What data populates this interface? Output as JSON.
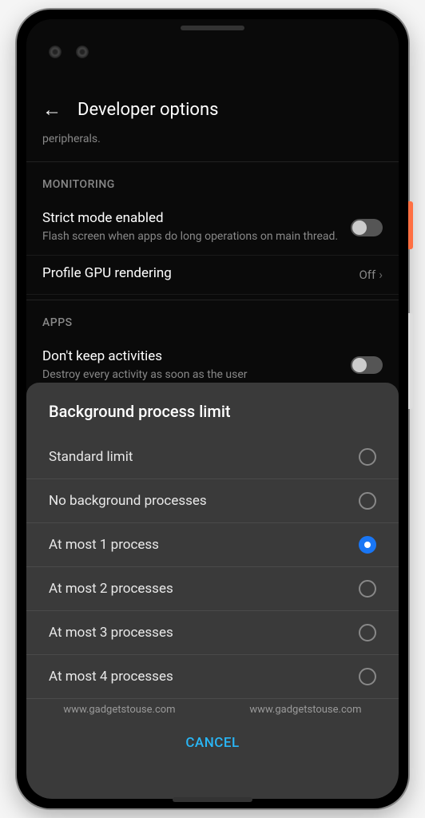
{
  "header": {
    "title": "Developer options"
  },
  "cutoff_text": "peripherals.",
  "sections": {
    "monitoring": {
      "label": "MONITORING",
      "strict_mode": {
        "title": "Strict mode enabled",
        "desc": "Flash screen when apps do long operations on main thread."
      },
      "gpu": {
        "title": "Profile GPU rendering",
        "value": "Off"
      }
    },
    "apps": {
      "label": "APPS",
      "keep_activities": {
        "title": "Don't keep activities",
        "desc": "Destroy every activity as soon as the user"
      }
    }
  },
  "dialog": {
    "title": "Background process limit",
    "options": [
      {
        "label": "Standard limit",
        "selected": false
      },
      {
        "label": "No background processes",
        "selected": false
      },
      {
        "label": "At most 1 process",
        "selected": true
      },
      {
        "label": "At most 2 processes",
        "selected": false
      },
      {
        "label": "At most 3 processes",
        "selected": false
      },
      {
        "label": "At most 4 processes",
        "selected": false
      }
    ],
    "cancel": "CANCEL"
  },
  "watermark": "www.gadgetstouse.com"
}
